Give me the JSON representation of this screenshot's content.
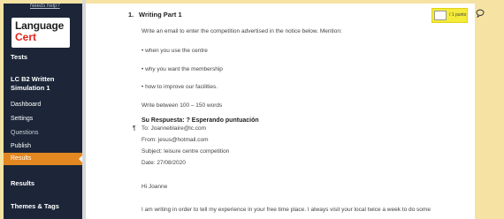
{
  "sidebar": {
    "top_link": "Needs help?",
    "logo_line1": "Language",
    "logo_line2": "Cert",
    "tests": "Tests",
    "course_title": "LC B2 Written Simulation 1",
    "items": [
      "Dashboard",
      "Settings",
      "Questions",
      "Publish",
      "Results"
    ],
    "results_section": "Results",
    "themes": "Themes & Tags"
  },
  "question": {
    "number": "1.",
    "title": "Writing Part 1",
    "points_value": "",
    "points_label": "/ 1 punto",
    "instruction": "Write an email to enter the competition advertised in the notice below. Mention:",
    "bullets": [
      "• when you use the centre",
      "• why you want the membership",
      "• how to improve our facilities."
    ],
    "word_count": "Write between 100 – 150 words"
  },
  "answer": {
    "header": "Su Respuesta:  ? Esperando puntuación",
    "pilcrow": "¶",
    "to": "To: Joanneblaire@lc.com",
    "from": "From: jesus@hotmail.com",
    "subject": "Subject: leisure centre competition",
    "date": "Date: 27/08/2020",
    "greeting": "Hi Joanne",
    "body": "I am writing in order to tell my experience in your free time place. I always visit your local twice a week to do some"
  }
}
